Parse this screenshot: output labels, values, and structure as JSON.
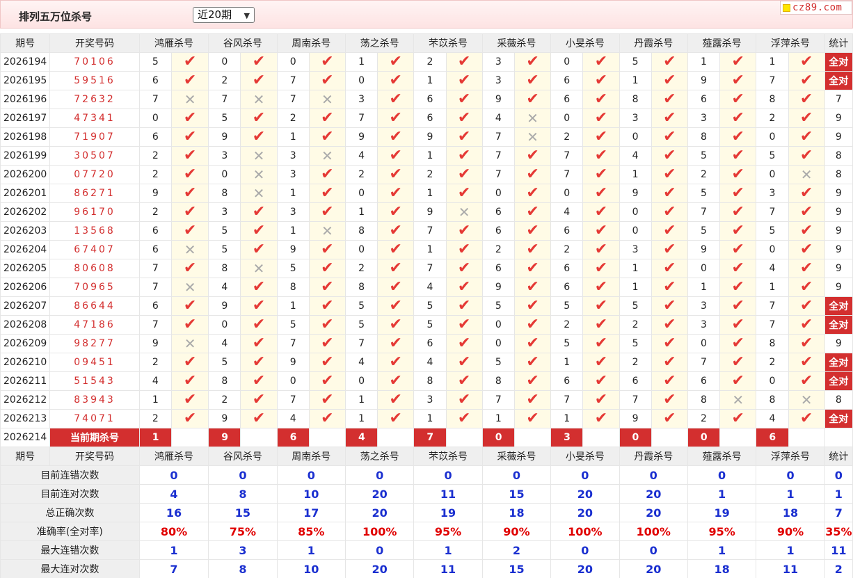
{
  "header": {
    "title": "排列五万位杀号",
    "period_select": "近20期",
    "site_logo": "cz89.com"
  },
  "columns": {
    "issue": "期号",
    "draw": "开奖号码",
    "experts": [
      "鸿雁杀号",
      "谷风杀号",
      "周南杀号",
      "荡之杀号",
      "芣苡杀号",
      "采薇杀号",
      "小旻杀号",
      "丹霞杀号",
      "薤露杀号",
      "浮萍杀号"
    ],
    "stat": "统计"
  },
  "rows": [
    {
      "issue": "2026194",
      "draw": "70106",
      "nums": [
        "5",
        "0",
        "0",
        "1",
        "2",
        "3",
        "0",
        "5",
        "1",
        "1"
      ],
      "marks": [
        1,
        1,
        1,
        1,
        1,
        1,
        1,
        1,
        1,
        1
      ],
      "stat": "全对"
    },
    {
      "issue": "2026195",
      "draw": "59516",
      "nums": [
        "6",
        "2",
        "7",
        "0",
        "1",
        "3",
        "6",
        "1",
        "9",
        "7"
      ],
      "marks": [
        1,
        1,
        1,
        1,
        1,
        1,
        1,
        1,
        1,
        1
      ],
      "stat": "全对"
    },
    {
      "issue": "2026196",
      "draw": "72632",
      "nums": [
        "7",
        "7",
        "7",
        "3",
        "6",
        "9",
        "6",
        "8",
        "6",
        "8"
      ],
      "marks": [
        0,
        0,
        0,
        1,
        1,
        1,
        1,
        1,
        1,
        1
      ],
      "stat": "7"
    },
    {
      "issue": "2026197",
      "draw": "47341",
      "nums": [
        "0",
        "5",
        "2",
        "7",
        "6",
        "4",
        "0",
        "3",
        "3",
        "2"
      ],
      "marks": [
        1,
        1,
        1,
        1,
        1,
        0,
        1,
        1,
        1,
        1
      ],
      "stat": "9"
    },
    {
      "issue": "2026198",
      "draw": "71907",
      "nums": [
        "6",
        "9",
        "1",
        "9",
        "9",
        "7",
        "2",
        "0",
        "8",
        "0"
      ],
      "marks": [
        1,
        1,
        1,
        1,
        1,
        0,
        1,
        1,
        1,
        1
      ],
      "stat": "9"
    },
    {
      "issue": "2026199",
      "draw": "30507",
      "nums": [
        "2",
        "3",
        "3",
        "4",
        "1",
        "7",
        "7",
        "4",
        "5",
        "5"
      ],
      "marks": [
        1,
        0,
        0,
        1,
        1,
        1,
        1,
        1,
        1,
        1
      ],
      "stat": "8"
    },
    {
      "issue": "2026200",
      "draw": "07720",
      "nums": [
        "2",
        "0",
        "3",
        "2",
        "2",
        "7",
        "7",
        "1",
        "2",
        "0"
      ],
      "marks": [
        1,
        0,
        1,
        1,
        1,
        1,
        1,
        1,
        1,
        0
      ],
      "stat": "8"
    },
    {
      "issue": "2026201",
      "draw": "86271",
      "nums": [
        "9",
        "8",
        "1",
        "0",
        "1",
        "0",
        "0",
        "9",
        "5",
        "3"
      ],
      "marks": [
        1,
        0,
        1,
        1,
        1,
        1,
        1,
        1,
        1,
        1
      ],
      "stat": "9"
    },
    {
      "issue": "2026202",
      "draw": "96170",
      "nums": [
        "2",
        "3",
        "3",
        "1",
        "9",
        "6",
        "4",
        "0",
        "7",
        "7"
      ],
      "marks": [
        1,
        1,
        1,
        1,
        0,
        1,
        1,
        1,
        1,
        1
      ],
      "stat": "9"
    },
    {
      "issue": "2026203",
      "draw": "13568",
      "nums": [
        "6",
        "5",
        "1",
        "8",
        "7",
        "6",
        "6",
        "0",
        "5",
        "5"
      ],
      "marks": [
        1,
        1,
        0,
        1,
        1,
        1,
        1,
        1,
        1,
        1
      ],
      "stat": "9"
    },
    {
      "issue": "2026204",
      "draw": "67407",
      "nums": [
        "6",
        "5",
        "9",
        "0",
        "1",
        "2",
        "2",
        "3",
        "9",
        "0"
      ],
      "marks": [
        0,
        1,
        1,
        1,
        1,
        1,
        1,
        1,
        1,
        1
      ],
      "stat": "9"
    },
    {
      "issue": "2026205",
      "draw": "80608",
      "nums": [
        "7",
        "8",
        "5",
        "2",
        "7",
        "6",
        "6",
        "1",
        "0",
        "4"
      ],
      "marks": [
        1,
        0,
        1,
        1,
        1,
        1,
        1,
        1,
        1,
        1
      ],
      "stat": "9"
    },
    {
      "issue": "2026206",
      "draw": "70965",
      "nums": [
        "7",
        "4",
        "8",
        "8",
        "4",
        "9",
        "6",
        "1",
        "1",
        "1"
      ],
      "marks": [
        0,
        1,
        1,
        1,
        1,
        1,
        1,
        1,
        1,
        1
      ],
      "stat": "9"
    },
    {
      "issue": "2026207",
      "draw": "86644",
      "nums": [
        "6",
        "9",
        "1",
        "5",
        "5",
        "5",
        "5",
        "5",
        "3",
        "7"
      ],
      "marks": [
        1,
        1,
        1,
        1,
        1,
        1,
        1,
        1,
        1,
        1
      ],
      "stat": "全对"
    },
    {
      "issue": "2026208",
      "draw": "47186",
      "nums": [
        "7",
        "0",
        "5",
        "5",
        "5",
        "0",
        "2",
        "2",
        "3",
        "7"
      ],
      "marks": [
        1,
        1,
        1,
        1,
        1,
        1,
        1,
        1,
        1,
        1
      ],
      "stat": "全对"
    },
    {
      "issue": "2026209",
      "draw": "98277",
      "nums": [
        "9",
        "4",
        "7",
        "7",
        "6",
        "0",
        "5",
        "5",
        "0",
        "8"
      ],
      "marks": [
        0,
        1,
        1,
        1,
        1,
        1,
        1,
        1,
        1,
        1
      ],
      "stat": "9"
    },
    {
      "issue": "2026210",
      "draw": "09451",
      "nums": [
        "2",
        "5",
        "9",
        "4",
        "4",
        "5",
        "1",
        "2",
        "7",
        "2"
      ],
      "marks": [
        1,
        1,
        1,
        1,
        1,
        1,
        1,
        1,
        1,
        1
      ],
      "stat": "全对"
    },
    {
      "issue": "2026211",
      "draw": "51543",
      "nums": [
        "4",
        "8",
        "0",
        "0",
        "8",
        "8",
        "6",
        "6",
        "6",
        "0"
      ],
      "marks": [
        1,
        1,
        1,
        1,
        1,
        1,
        1,
        1,
        1,
        1
      ],
      "stat": "全对"
    },
    {
      "issue": "2026212",
      "draw": "83943",
      "nums": [
        "1",
        "2",
        "7",
        "1",
        "3",
        "7",
        "7",
        "7",
        "8",
        "8"
      ],
      "marks": [
        1,
        1,
        1,
        1,
        1,
        1,
        1,
        1,
        0,
        0
      ],
      "stat": "8"
    },
    {
      "issue": "2026213",
      "draw": "74071",
      "nums": [
        "2",
        "9",
        "4",
        "1",
        "1",
        "1",
        "1",
        "9",
        "2",
        "4"
      ],
      "marks": [
        1,
        1,
        1,
        1,
        1,
        1,
        1,
        1,
        1,
        1
      ],
      "stat": "全对"
    }
  ],
  "current": {
    "issue": "2026214",
    "label": "当前期杀号",
    "nums": [
      "1",
      "9",
      "6",
      "4",
      "7",
      "0",
      "3",
      "0",
      "0",
      "6"
    ]
  },
  "summary": [
    {
      "label": "目前连错次数",
      "vals": [
        "0",
        "0",
        "0",
        "0",
        "0",
        "0",
        "0",
        "0",
        "0",
        "0"
      ],
      "stat": "0"
    },
    {
      "label": "目前连对次数",
      "vals": [
        "4",
        "8",
        "10",
        "20",
        "11",
        "15",
        "20",
        "20",
        "1",
        "1"
      ],
      "stat": "1"
    },
    {
      "label": "总正确次数",
      "vals": [
        "16",
        "15",
        "17",
        "20",
        "19",
        "18",
        "20",
        "20",
        "19",
        "18"
      ],
      "stat": "7"
    },
    {
      "label": "准确率(全对率)",
      "vals": [
        "80%",
        "75%",
        "85%",
        "100%",
        "95%",
        "90%",
        "100%",
        "100%",
        "95%",
        "90%"
      ],
      "stat": "35%"
    },
    {
      "label": "最大连错次数",
      "vals": [
        "1",
        "3",
        "1",
        "0",
        "1",
        "2",
        "0",
        "0",
        "1",
        "1"
      ],
      "stat": "11"
    },
    {
      "label": "最大连对次数",
      "vals": [
        "7",
        "8",
        "10",
        "20",
        "11",
        "15",
        "20",
        "20",
        "18",
        "11"
      ],
      "stat": "2"
    }
  ],
  "stat_all_label": "全对",
  "icons": {
    "correct": "check-icon",
    "wrong": "cross-icon"
  },
  "colors": {
    "accent_red": "#d32f2f",
    "summary_blue": "#1a2fd0",
    "mark_bg": "#fffbe6"
  }
}
